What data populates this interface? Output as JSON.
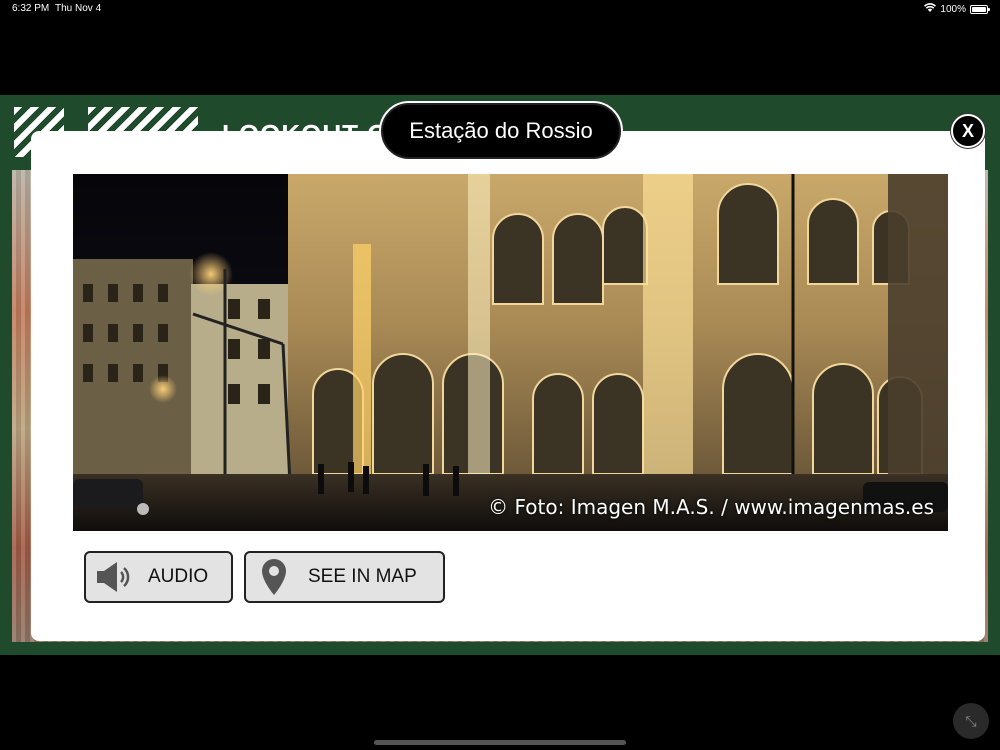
{
  "status_bar": {
    "time": "6:32 PM",
    "date": "Thu Nov 4",
    "battery_text": "100%",
    "battery_level": 1.0
  },
  "app": {
    "title": "LOOKOUT OF SÃO JORGE",
    "accent_color": "#1f4a2c"
  },
  "modal": {
    "title": "Estação do Rossio",
    "close_label": "X",
    "photo_credit": "© Foto: Imagen M.A.S. / www.imagenmas.es",
    "buttons": {
      "audio_label": "AUDIO",
      "map_label": "SEE IN MAP"
    },
    "icons": {
      "audio": "speaker-icon",
      "map": "map-pin-icon"
    }
  }
}
